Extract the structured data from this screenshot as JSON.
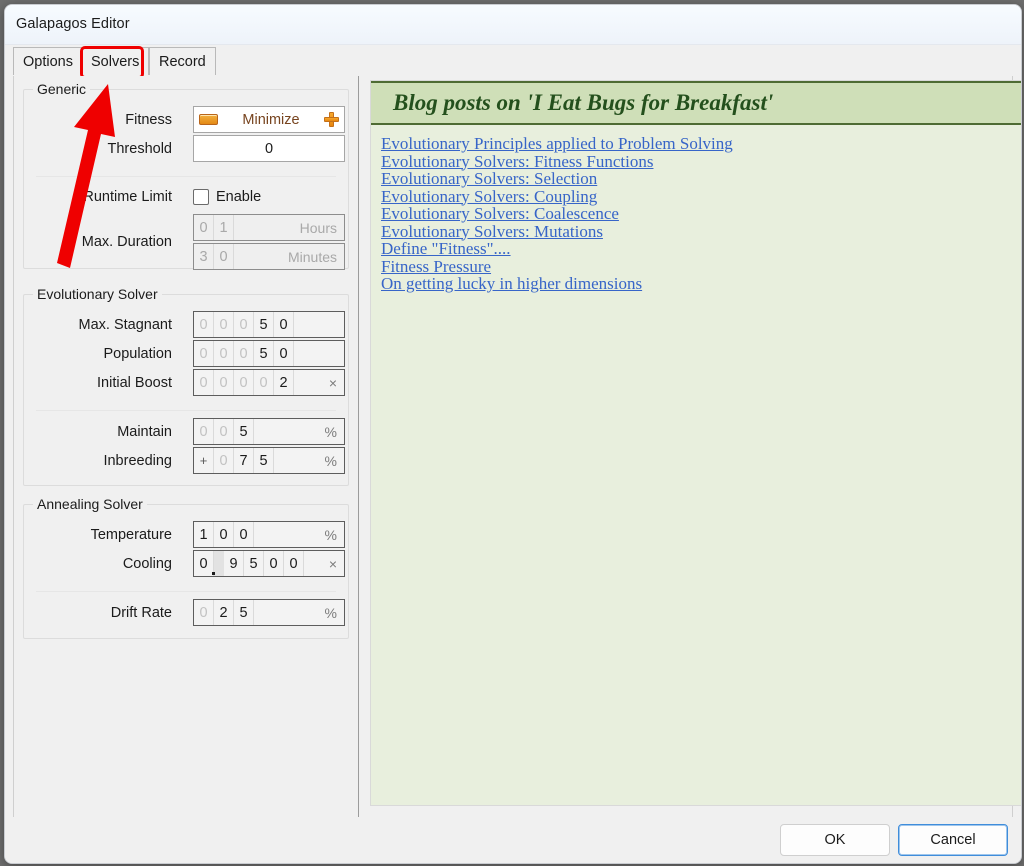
{
  "window": {
    "title": "Galapagos Editor"
  },
  "tabs": [
    {
      "label": "Options",
      "selected": false
    },
    {
      "label": "Solvers",
      "selected": true
    },
    {
      "label": "Record",
      "selected": false
    }
  ],
  "annotation": {
    "highlight_color": "#ef0000",
    "arrow_color": "#ef0000",
    "target": "Solvers"
  },
  "groups": {
    "generic": {
      "legend": "Generic",
      "fitness": {
        "label": "Fitness",
        "value": "Minimize",
        "minus_icon": "minus-icon",
        "plus_icon": "plus-icon"
      },
      "threshold": {
        "label": "Threshold",
        "value": "0"
      },
      "runtime_limit": {
        "label": "Runtime Limit",
        "checkbox_label": "Enable",
        "checked": false
      },
      "max_duration": {
        "label": "Max. Duration",
        "hours": {
          "digits": [
            "0",
            "1"
          ],
          "dim": [
            true,
            false
          ],
          "unit": "Hours",
          "disabled": true
        },
        "minutes": {
          "digits": [
            "3",
            "0"
          ],
          "dim": [
            false,
            false
          ],
          "unit": "Minutes",
          "disabled": true
        }
      }
    },
    "evolutionary": {
      "legend": "Evolutionary Solver",
      "rows": [
        {
          "label": "Max. Stagnant",
          "digits": [
            "0",
            "0",
            "0",
            "5",
            "0"
          ],
          "dim": [
            true,
            true,
            true,
            false,
            false
          ],
          "unit": ""
        },
        {
          "label": "Population",
          "digits": [
            "0",
            "0",
            "0",
            "5",
            "0"
          ],
          "dim": [
            true,
            true,
            true,
            false,
            false
          ],
          "unit": ""
        },
        {
          "label": "Initial Boost",
          "digits": [
            "0",
            "0",
            "0",
            "0",
            "2"
          ],
          "dim": [
            true,
            true,
            true,
            true,
            false
          ],
          "unit": "×"
        },
        {
          "label": "Maintain",
          "digits": [
            "0",
            "0",
            "5"
          ],
          "dim": [
            true,
            true,
            false
          ],
          "unit": "%"
        },
        {
          "label": "Inbreeding",
          "digits": [
            "+",
            "0",
            "7",
            "5"
          ],
          "dim": [
            false,
            true,
            false,
            false
          ],
          "unit": "%",
          "sign": true
        }
      ]
    },
    "annealing": {
      "legend": "Annealing Solver",
      "rows": [
        {
          "label": "Temperature",
          "digits": [
            "1",
            "0",
            "0"
          ],
          "dim": [
            false,
            false,
            false
          ],
          "unit": "%"
        },
        {
          "label": "Cooling",
          "digits": [
            "0",
            ".",
            "9",
            "5",
            "0",
            "0"
          ],
          "dim": [
            false,
            false,
            false,
            false,
            false,
            false
          ],
          "unit": "×",
          "decimal_index": 1
        },
        {
          "label": "Drift Rate",
          "digits": [
            "0",
            "2",
            "5"
          ],
          "dim": [
            true,
            false,
            false
          ],
          "unit": "%"
        }
      ]
    }
  },
  "blog": {
    "header": "Blog posts on 'I Eat Bugs for Breakfast'",
    "header_bg": "#cfdfb8",
    "body_bg": "#e8efdd",
    "link_color": "#3765c8",
    "links": [
      "Evolutionary Principles applied to Problem Solving",
      "Evolutionary Solvers: Fitness Functions",
      "Evolutionary Solvers: Selection",
      "Evolutionary Solvers: Coupling",
      "Evolutionary Solvers: Coalescence",
      "Evolutionary Solvers: Mutations",
      "Define \"Fitness\"....",
      "Fitness Pressure",
      "On getting lucky in higher dimensions"
    ]
  },
  "footer": {
    "ok": "OK",
    "cancel": "Cancel"
  }
}
